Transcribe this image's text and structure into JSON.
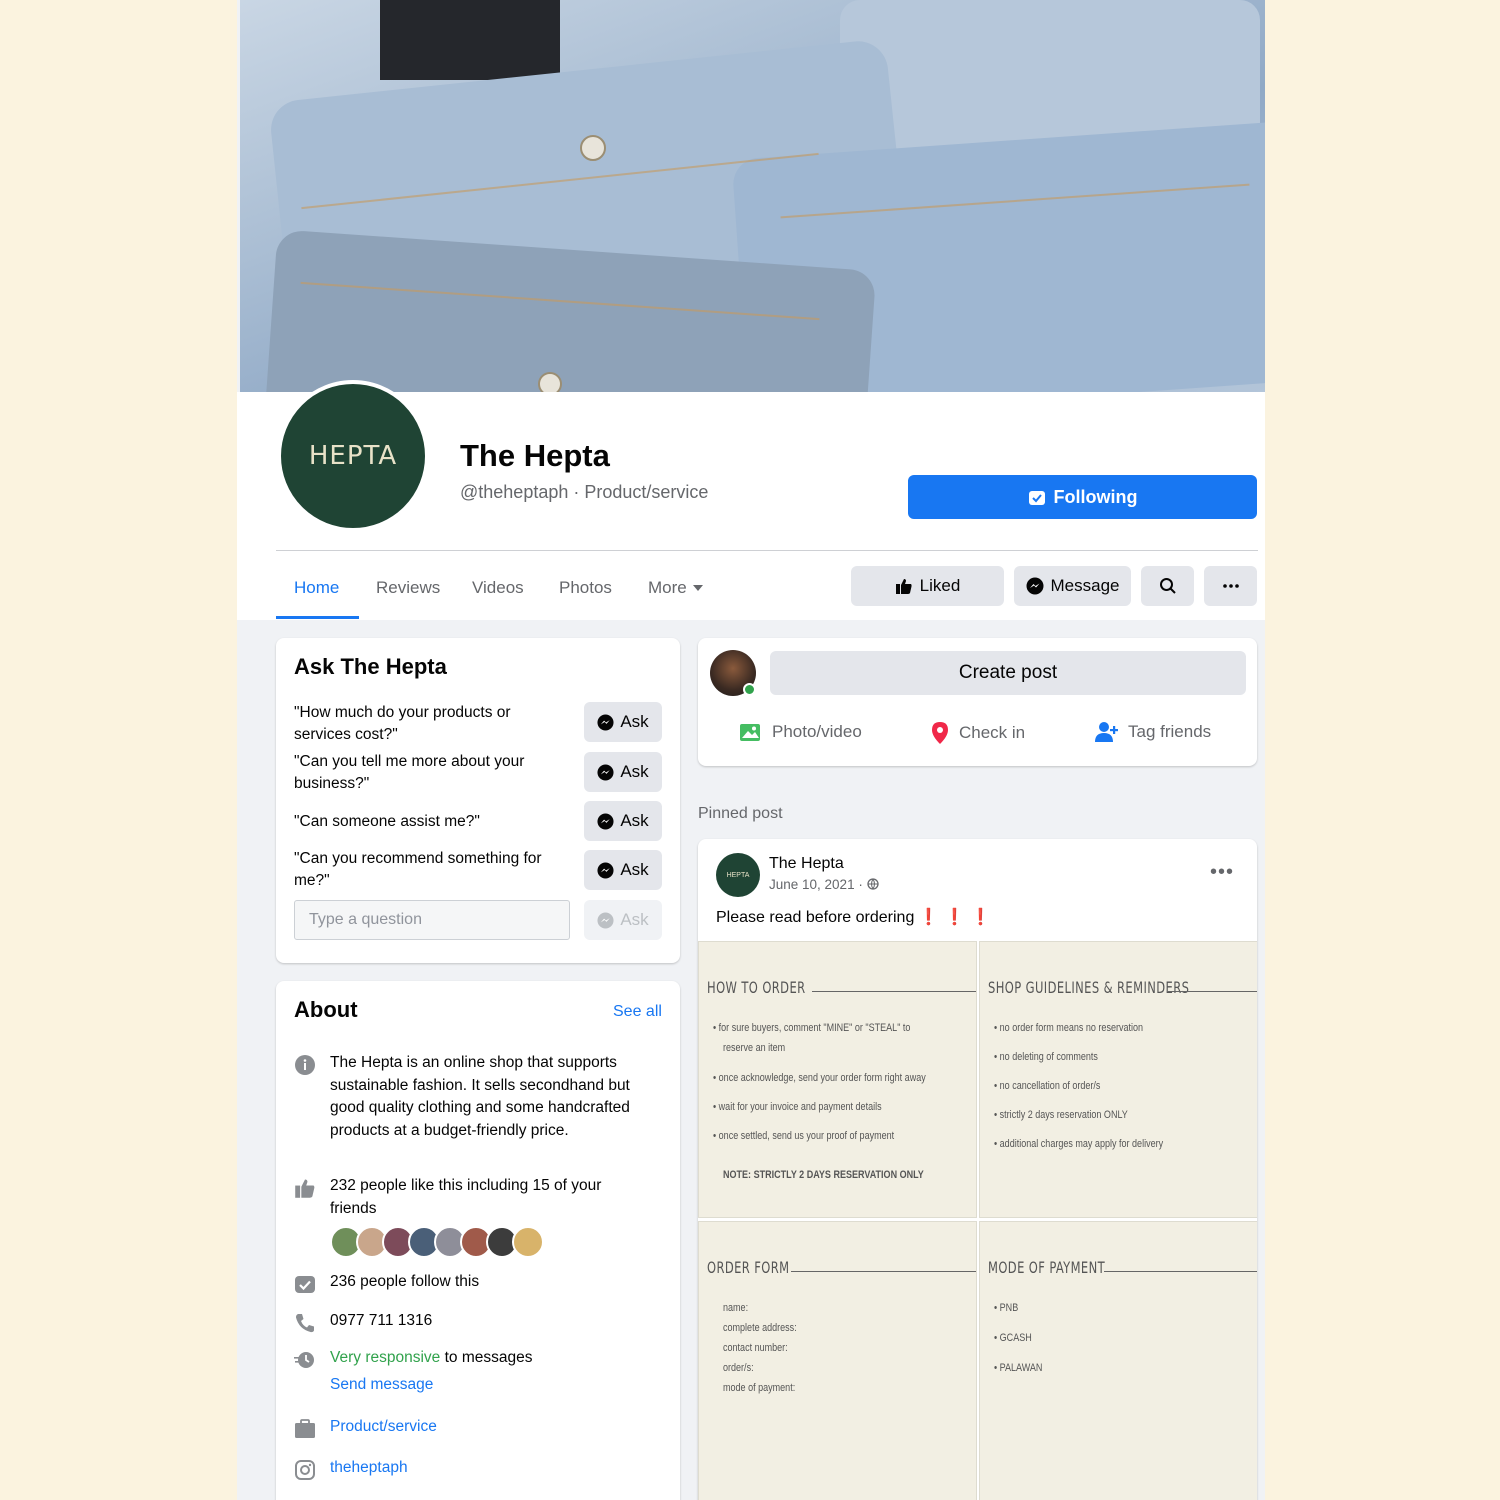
{
  "page": {
    "name": "The Hepta",
    "subtitle": "@theheptaph · Product/service",
    "avatar_text": "HEPTA",
    "following_label": "Following",
    "brand_color": "#1877f2",
    "avatar_color": "#1f4434"
  },
  "tabs": [
    {
      "label": "Home",
      "active": true
    },
    {
      "label": "Reviews"
    },
    {
      "label": "Videos"
    },
    {
      "label": "Photos"
    },
    {
      "label": "More"
    }
  ],
  "actions": {
    "liked": "Liked",
    "message": "Message"
  },
  "ask": {
    "title": "Ask The Hepta",
    "questions": [
      "\"How much do your products or services cost?\"",
      "\"Can you tell me more about your business?\"",
      "\"Can someone assist me?\"",
      "\"Can you recommend something for me?\""
    ],
    "ask_label": "Ask",
    "input_placeholder": "Type a question"
  },
  "about": {
    "title": "About",
    "see_all": "See all",
    "description": "The Hepta is an online shop that supports sustainable fashion. It sells secondhand but good quality clothing and some handcrafted products at a budget-friendly price.",
    "likes": "232 people like this including 15 of your friends",
    "follows": "236 people follow this",
    "phone": "0977 711 1316",
    "responsive": "Very responsive",
    "responsive_rest": " to messages",
    "send_message": "Send message",
    "category": "Product/service",
    "instagram": "theheptaph"
  },
  "create_post": {
    "placeholder": "Create post",
    "photo_video": "Photo/video",
    "check_in": "Check in",
    "tag_friends": "Tag friends"
  },
  "pinned_label": "Pinned post",
  "post": {
    "author": "The Hepta",
    "date": "June 10, 2021 · ",
    "text": "Please read before ordering",
    "emphasis": "❗❗❗",
    "sheets": {
      "how_to_order": {
        "title": "HOW TO ORDER",
        "items": [
          "• for sure buyers, comment \"MINE\" or \"STEAL\" to",
          "reserve an item",
          "• once acknowledge, send your order form right away",
          "• wait for your invoice and payment details",
          "• once settled, send us your proof of payment",
          "NOTE: STRICTLY 2 DAYS RESERVATION ONLY"
        ]
      },
      "guidelines": {
        "title": "SHOP GUIDELINES & REMINDERS",
        "items": [
          "• no order form means no reservation",
          "• no deleting of comments",
          "• no cancellation of order/s",
          "• strictly 2 days reservation ONLY",
          "• additional charges may apply for delivery"
        ]
      },
      "order_form": {
        "title": "ORDER FORM",
        "items": [
          "name:",
          "complete address:",
          "contact number:",
          "order/s:",
          "mode of payment:"
        ]
      },
      "payment": {
        "title": "MODE OF PAYMENT",
        "items": [
          "• PNB",
          "• GCASH",
          "• PALAWAN"
        ]
      }
    }
  }
}
